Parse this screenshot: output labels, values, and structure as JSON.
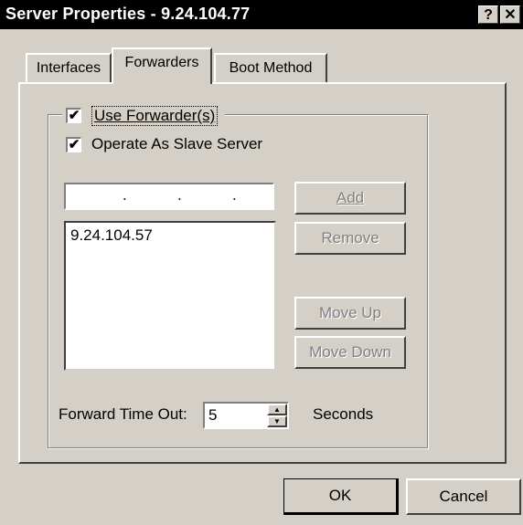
{
  "window": {
    "title": "Server Properties - 9.24.104.77",
    "help_glyph": "?",
    "close_glyph": "✕"
  },
  "tabs": [
    {
      "label": "Interfaces",
      "active": false
    },
    {
      "label": "Forwarders",
      "active": true
    },
    {
      "label": "Boot Method",
      "active": false
    }
  ],
  "forwarders": {
    "use_forwarders": {
      "label": "Use Forwarder(s)",
      "checked": true,
      "mark": "✔"
    },
    "slave_server": {
      "label": "Operate As Slave Server",
      "checked": true,
      "mark": "✔"
    },
    "ip_input": {
      "dots": [
        ".",
        ".",
        "."
      ],
      "value": ""
    },
    "list_items": [
      "9.24.104.57"
    ],
    "buttons": {
      "add": "Add",
      "remove": "Remove",
      "move_up": "Move Up",
      "move_down": "Move Down"
    },
    "timeout": {
      "label": "Forward Time Out:",
      "value": "5",
      "unit": "Seconds",
      "up_glyph": "▲",
      "down_glyph": "▼"
    }
  },
  "footer": {
    "ok": "OK",
    "cancel": "Cancel"
  }
}
